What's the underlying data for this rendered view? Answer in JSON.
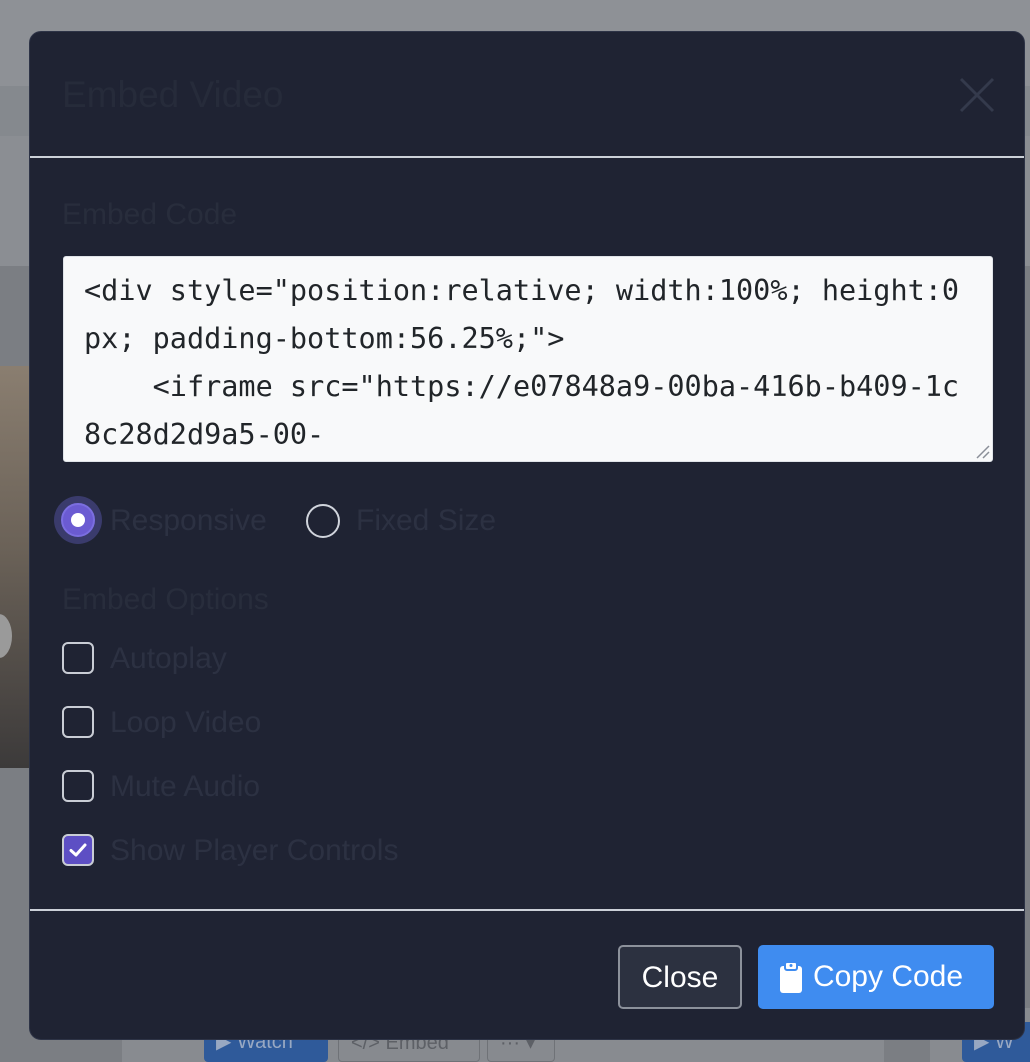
{
  "background": {
    "watch_button": "▶ Watch",
    "embed_button": "</> Embed",
    "more_button": "··· ▾",
    "watch_button_2": "▶ W"
  },
  "modal": {
    "title": "Embed Video",
    "embed_code_label": "Embed Code",
    "embed_code": "<div style=\"position:relative; width:100%; height:0px; padding-bottom:56.25%;\">\n    <iframe src=\"https://e07848a9-00ba-416b-b409-1c8c28d2d9a5-00-",
    "size_mode": {
      "options": [
        {
          "label": "Responsive",
          "selected": true
        },
        {
          "label": "Fixed Size",
          "selected": false
        }
      ]
    },
    "embed_options_label": "Embed Options",
    "options": {
      "autoplay": {
        "label": "Autoplay",
        "checked": false
      },
      "loop": {
        "label": "Loop Video",
        "checked": false
      },
      "mute": {
        "label": "Mute Audio",
        "checked": false
      },
      "controls": {
        "label": "Show Player Controls",
        "checked": true
      }
    },
    "footer": {
      "close_label": "Close",
      "copy_label": "Copy Code"
    }
  },
  "colors": {
    "modal_bg": "#1f2333",
    "accent_primary": "#3f8cf0",
    "radio_checked": "#6b5bd2",
    "checkbox_checked": "#5d4fc4"
  },
  "icons": {
    "close": "close-icon",
    "clipboard": "clipboard-icon",
    "checkmark": "checkmark-icon",
    "resize": "resize-grip-icon"
  }
}
